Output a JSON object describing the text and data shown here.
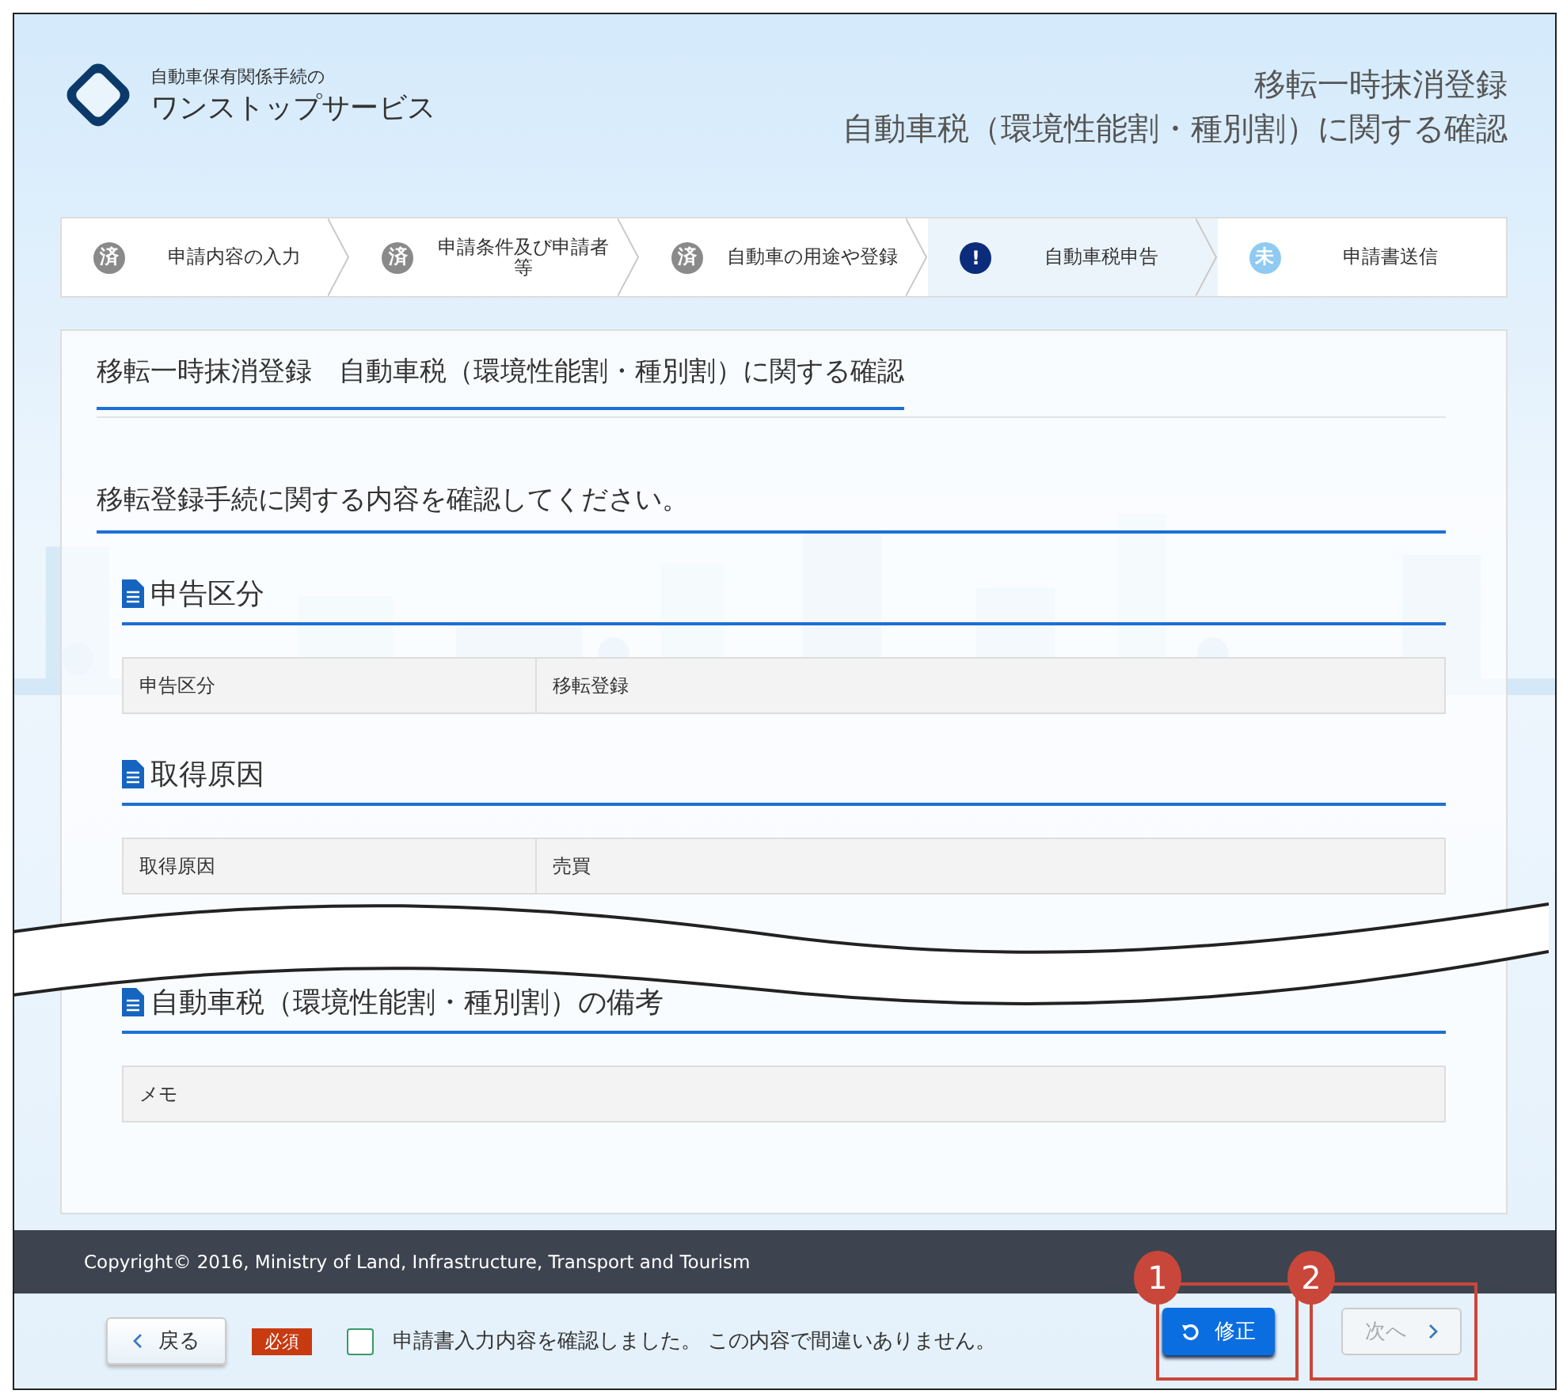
{
  "header": {
    "service_caption": "自動車保有関係手続の",
    "service_name": "ワンストップサービス",
    "title_lines": [
      "移転一時抹消登録",
      "自動車税（環境性能割・種別割）に関する確認"
    ]
  },
  "steps": [
    {
      "badge": "済",
      "label": "申請内容の入力",
      "kind": "done"
    },
    {
      "badge": "済",
      "label": "申請条件及び申請者等",
      "kind": "done"
    },
    {
      "badge": "済",
      "label": "自動車の用途や登録",
      "kind": "done"
    },
    {
      "badge": "!",
      "label": "自動車税申告",
      "kind": "current"
    },
    {
      "badge": "未",
      "label": "申請書送信",
      "kind": "pending"
    }
  ],
  "card": {
    "title": "移転一時抹消登録　自動車税（環境性能割・種別割）に関する確認",
    "instruction": "移転登録手続に関する内容を確認してください。",
    "sections": [
      {
        "heading": "申告区分",
        "rows": [
          {
            "label": "申告区分",
            "value": "移転登録"
          }
        ]
      },
      {
        "heading": "取得原因",
        "rows": [
          {
            "label": "取得原因",
            "value": "売買"
          }
        ]
      },
      {
        "heading": "自動車税（環境性能割・種別割）の備考",
        "cut_before": true,
        "rows": [
          {
            "label": "メモ"
          }
        ]
      }
    ]
  },
  "footer": {
    "copyright": "Copyright© 2016, Ministry of Land, Infrastructure, Transport and Tourism"
  },
  "actions": {
    "back": "戻る",
    "required_badge": "必須",
    "confirm": {
      "label": "申請書入力内容を確認しました。 この内容で間違いありません。",
      "checked": false
    },
    "edit": {
      "label": "修正",
      "callout": "1"
    },
    "next": {
      "label": "次へ",
      "disabled": true,
      "callout": "2"
    }
  }
}
